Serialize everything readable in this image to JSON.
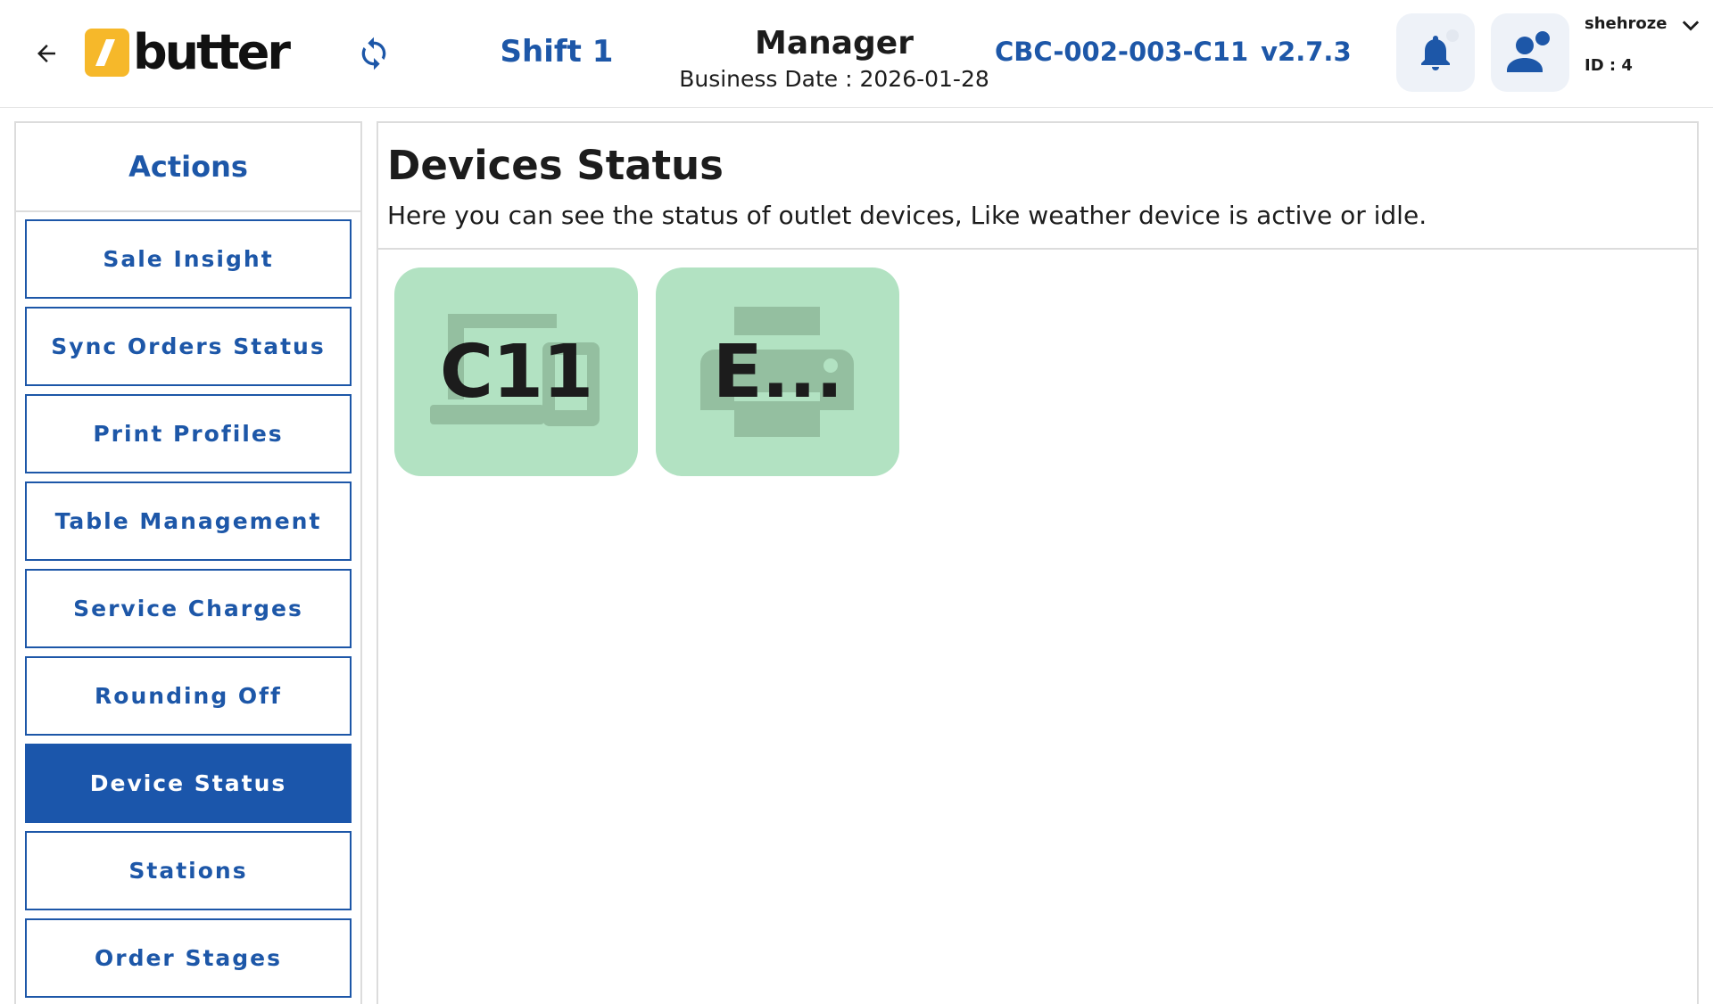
{
  "header": {
    "shift": "Shift 1",
    "role": "Manager",
    "business_date": "Business Date : 2026-01-28",
    "device_code": "CBC-002-003-C11",
    "version": "v2.7.3",
    "user_name": "shehroze",
    "user_id": "ID : 4",
    "logo_text": "butter",
    "brand_color": "#f6b82a",
    "accent_color": "#1d57a8"
  },
  "sidebar": {
    "title": "Actions",
    "items": [
      {
        "label": "Sale Insight",
        "active": false
      },
      {
        "label": "Sync Orders Status",
        "active": false
      },
      {
        "label": "Print Profiles",
        "active": false
      },
      {
        "label": "Table Management",
        "active": false
      },
      {
        "label": "Service Charges",
        "active": false
      },
      {
        "label": "Rounding Off",
        "active": false
      },
      {
        "label": "Device Status",
        "active": true
      },
      {
        "label": "Stations",
        "active": false
      },
      {
        "label": "Order Stages",
        "active": false
      }
    ]
  },
  "main": {
    "title": "Devices Status",
    "description": "Here you can see the status of outlet devices, Like weather device is active or idle.",
    "devices": [
      {
        "label": "C11",
        "icon": "devices-icon",
        "status_color": "#b2e2c2"
      },
      {
        "label": "E...",
        "icon": "printer-icon",
        "status_color": "#b2e2c2"
      }
    ]
  }
}
